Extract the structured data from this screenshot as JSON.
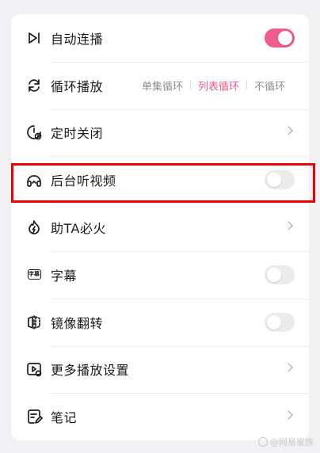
{
  "settings": {
    "items": [
      {
        "label": "自动连播",
        "icon": "play-next-icon",
        "control": "toggle",
        "enabled": true
      },
      {
        "label": "循环播放",
        "icon": "loop-icon",
        "control": "options",
        "options": [
          "单集循环",
          "列表循环",
          "不循环"
        ],
        "selected": "列表循环"
      },
      {
        "label": "定时关闭",
        "icon": "timer-icon",
        "control": "chevron"
      },
      {
        "label": "后台听视频",
        "icon": "headphones-icon",
        "control": "toggle",
        "enabled": false
      },
      {
        "label": "助TA必火",
        "icon": "fire-icon",
        "control": "chevron"
      },
      {
        "label": "字幕",
        "icon": "subtitle-icon",
        "control": "toggle",
        "enabled": false,
        "icon_text": "字幕"
      },
      {
        "label": "镜像翻转",
        "icon": "mirror-flip-icon",
        "control": "toggle",
        "enabled": false
      },
      {
        "label": "更多播放设置",
        "icon": "play-settings-icon",
        "control": "chevron"
      },
      {
        "label": "笔记",
        "icon": "note-icon",
        "control": "chevron"
      }
    ]
  },
  "colors": {
    "accent": "#ef5c8e",
    "highlight_box": "#ee0000",
    "toggle_off": "#ebebeb"
  },
  "watermark": {
    "text": "@网易家族"
  }
}
